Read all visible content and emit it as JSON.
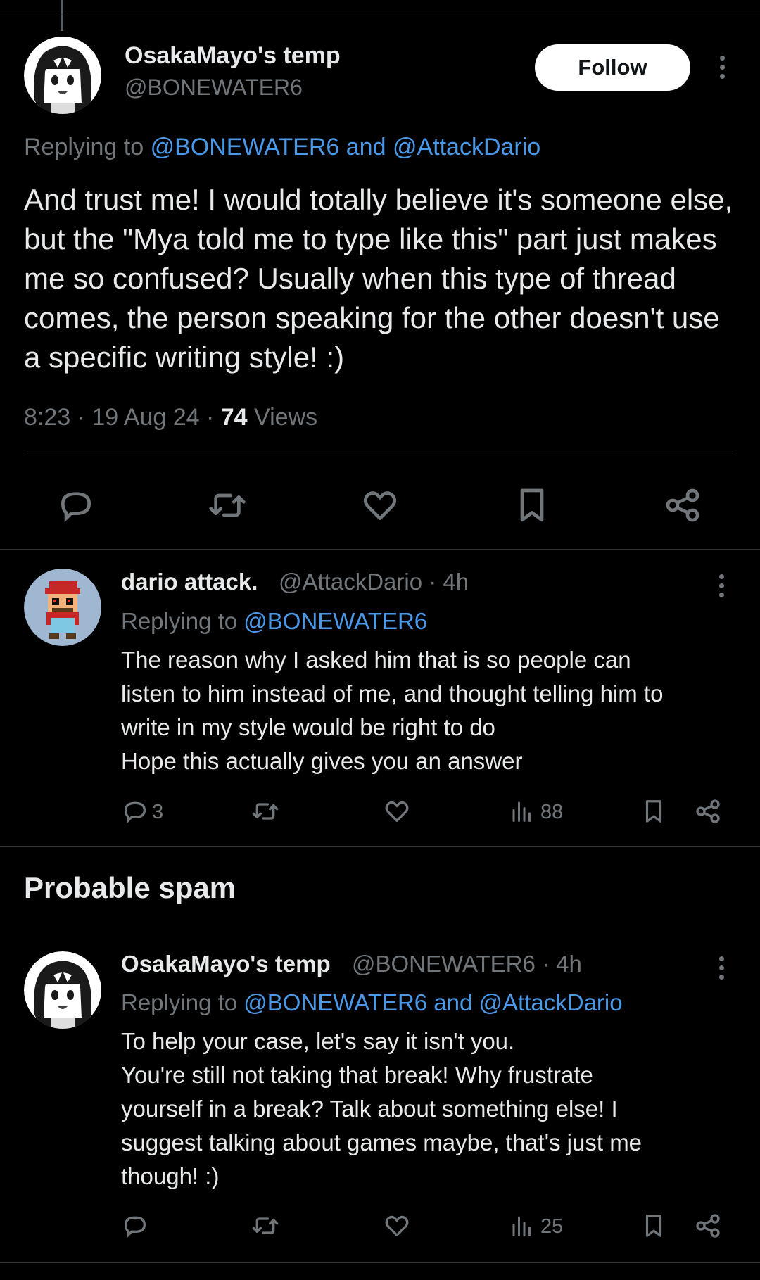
{
  "main_tweet": {
    "display_name": "OsakaMayo's temp",
    "handle": "@BONEWATER6",
    "follow_label": "Follow",
    "replying_prefix": "Replying to",
    "replying_to": "@BONEWATER6 and @AttackDario",
    "text": "And trust me! I would totally believe it's someone else, but the \"Mya told me to type like this\" part just makes me so confused? Usually when this type of thread comes, the person speaking for the other doesn't use a specific writing style! :)",
    "time_date": "8:23 · 19 Aug 24 ·",
    "views_count": "74",
    "views_label": "Views",
    "actions": [
      "reply-icon",
      "repost-icon",
      "like-icon",
      "bookmark-icon",
      "share-icon"
    ]
  },
  "reply_1": {
    "display_name": "dario attack.",
    "handle_time": "@AttackDario · 4h",
    "replying_prefix": "Replying to",
    "replying_to": "@BONEWATER6",
    "lines": [
      "The reason why I asked him that is so people can",
      "listen to him instead of me, and thought telling him to",
      "write in my style would be right to do",
      "Hope this actually gives you an answer"
    ],
    "reply_count": "3",
    "views_count": "88"
  },
  "section": {
    "title": "Probable spam"
  },
  "reply_2": {
    "display_name": "OsakaMayo's temp",
    "handle_time": "@BONEWATER6 · 4h",
    "replying_prefix": "Replying to",
    "replying_to": "@BONEWATER6 and @AttackDario",
    "lines": [
      "To help your case, let's say it isn't you.",
      "You're still not taking that break! Why frustrate",
      "yourself in a break? Talk about something else! I",
      "suggest talking about games maybe, that's just me",
      "though! :)"
    ],
    "views_count": "25"
  },
  "colors": {
    "background": "#000000",
    "text": "#e7e9ea",
    "secondary": "#71767b",
    "link": "#4a99e9",
    "divider": "#2f3336"
  }
}
